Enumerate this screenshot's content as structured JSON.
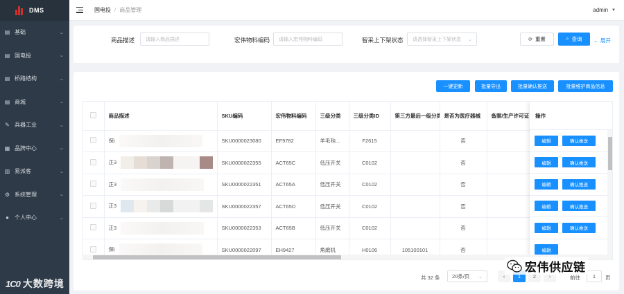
{
  "app": {
    "logo_text": "DMS"
  },
  "sidebar": {
    "items": [
      {
        "label": "基础",
        "icon": "doc-icon"
      },
      {
        "label": "国电投",
        "icon": "doc-icon"
      },
      {
        "label": "桥路结构",
        "icon": "doc-icon"
      },
      {
        "label": "商城",
        "icon": "doc-icon"
      },
      {
        "label": "兵器工业",
        "icon": "edit-icon"
      },
      {
        "label": "品牌中心",
        "icon": "chart-icon"
      },
      {
        "label": "易派客",
        "icon": "book-icon"
      },
      {
        "label": "系统管理",
        "icon": "gear-icon"
      },
      {
        "label": "个人中心",
        "icon": "user-icon"
      }
    ],
    "watermark": "大数跨境"
  },
  "header": {
    "breadcrumb": [
      "国电投",
      "商品管理"
    ],
    "user": "admin"
  },
  "filters": {
    "fields": [
      {
        "label": "商品描述",
        "placeholder": "请输入商品描述"
      },
      {
        "label": "宏伟物料编码",
        "placeholder": "请输入宏伟物料编码"
      },
      {
        "label": "智采上下架状态",
        "placeholder": "请选择智采上下架状态"
      }
    ],
    "reset_label": "重置",
    "query_label": "查询",
    "expand_label": "展开"
  },
  "toolbar": {
    "buttons": [
      "一键更新",
      "批量导出",
      "批量确认推送",
      "批量维护商品信息"
    ]
  },
  "table": {
    "headers": [
      "商品描述",
      "SKU编码",
      "宏伟物料编码",
      "三级分类",
      "三级分类ID",
      "第三方最后一级分类",
      "是否为医疗器械",
      "备案/生产许可证",
      "操作"
    ],
    "rows": [
      {
        "desc": "保i",
        "sku": "SKU0000023080",
        "code": "EF9782",
        "cat3": "羊毛毡...",
        "cat3id": "F2615",
        "third": "",
        "medical": "否"
      },
      {
        "desc": "正3",
        "sku": "SKU0000022355",
        "code": "ACT65C",
        "cat3": "低压开关",
        "cat3id": "C0102",
        "third": "",
        "medical": "否"
      },
      {
        "desc": "正3",
        "sku": "SKU0000022351",
        "code": "ACT65A",
        "cat3": "低压开关",
        "cat3id": "C0102",
        "third": "",
        "medical": "否"
      },
      {
        "desc": "正3",
        "sku": "SKU0000022357",
        "code": "ACT65D",
        "cat3": "低压开关",
        "cat3id": "C0102",
        "third": "",
        "medical": "否"
      },
      {
        "desc": "正3",
        "sku": "SKU0000022353",
        "code": "ACT65B",
        "cat3": "低压开关",
        "cat3id": "C0102",
        "third": "",
        "medical": "否"
      },
      {
        "desc": "保i",
        "sku": "SKU0000022097",
        "code": "EH9427",
        "cat3": "角磨机",
        "cat3id": "H0106",
        "third": "105100101",
        "medical": "否"
      }
    ],
    "edit_label": "编辑",
    "confirm_label": "确认推送"
  },
  "pagination": {
    "total": "共 32 条",
    "page_size": "20条/页",
    "pages": [
      "1",
      "2"
    ],
    "goto_label": "前往",
    "goto_value": "1",
    "page_suffix": "页"
  },
  "watermark_right": "宏伟供应链",
  "colors": {
    "sidebar": "#2e3a47",
    "primary": "#1890ff"
  }
}
